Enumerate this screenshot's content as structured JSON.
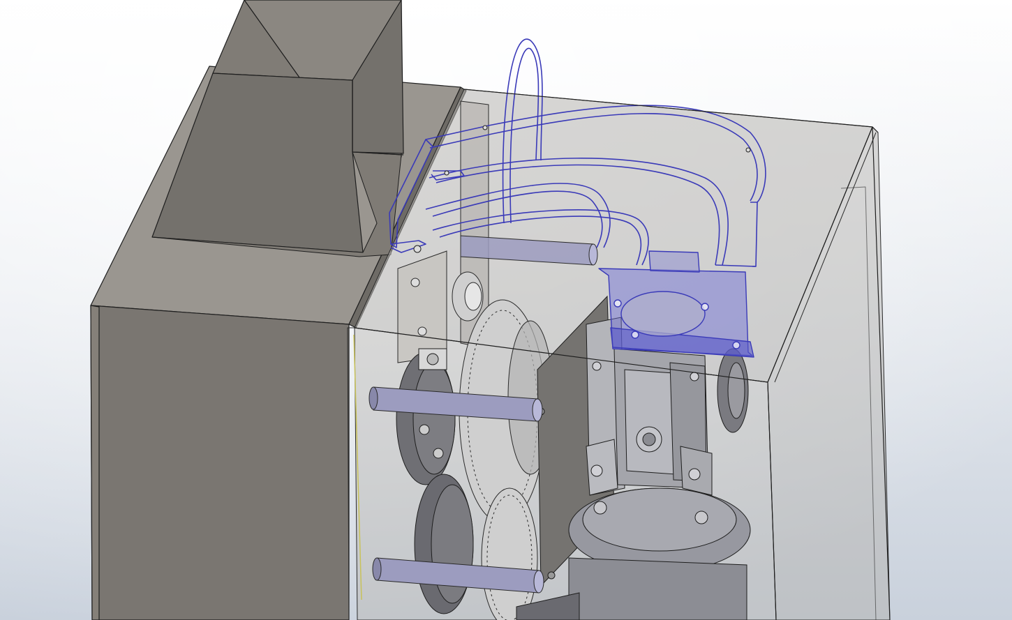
{
  "viewport": {
    "background_top": "#ffffff",
    "background_bottom": "#c9d1dc"
  },
  "colors": {
    "housing_left_face": "#7a7671",
    "housing_top": "#9a9690",
    "hopper_front": "#74716c",
    "hopper_side": "#8b8781",
    "transparent_panel": "#b7b4b0",
    "edge": "#1e1e1e",
    "selection_fill": "#6b6bd8",
    "selection_edge": "#3a3ab8",
    "rod": "#9c9cbf",
    "gear": "#cfcfcf",
    "metal_dark": "#6f6f74",
    "gearbox": "#a4a5ab"
  },
  "components": [
    "hopper",
    "left-housing",
    "transparent-enclosure",
    "selected-cable-guide",
    "motor-bracket",
    "support-rods",
    "spur-gear",
    "spindle-wheel",
    "worm-gearbox",
    "motor-base"
  ]
}
